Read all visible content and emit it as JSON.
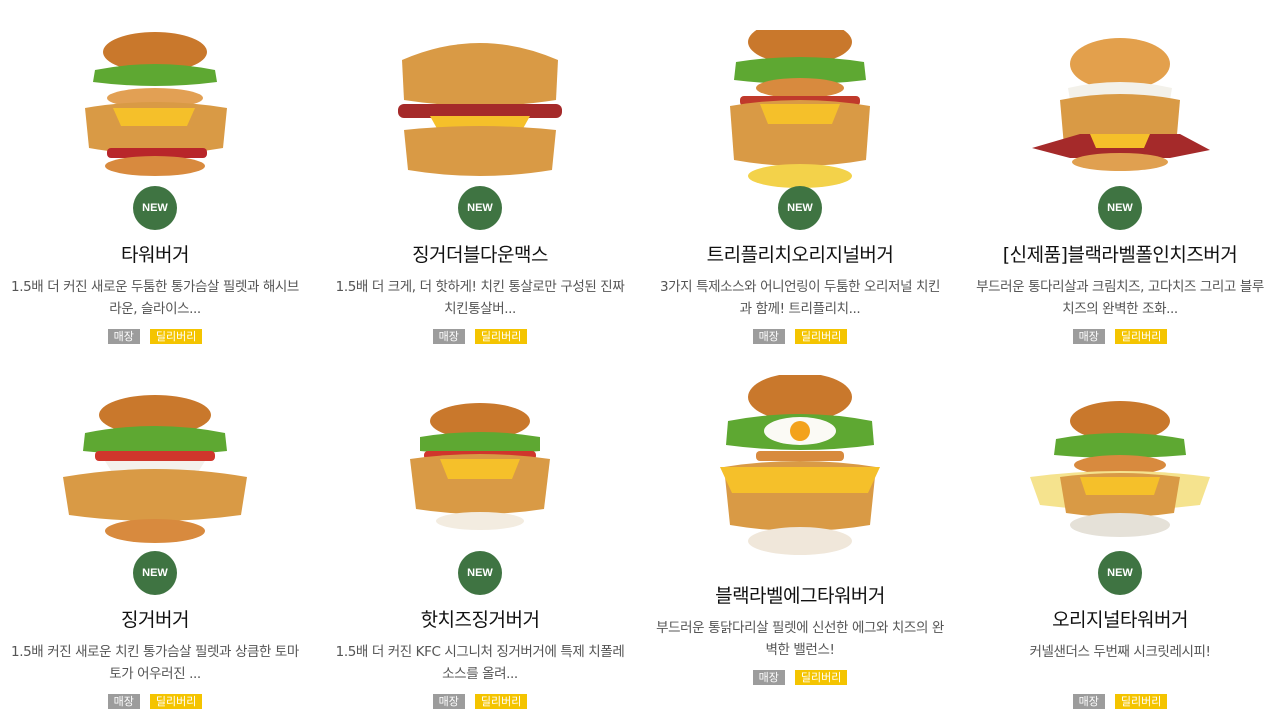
{
  "menu": {
    "items": [
      {
        "name": "타워버거",
        "desc": "1.5배 더 커진 새로운 두툼한 통가슴살 필렛과 해시브라운, 슬라이스...",
        "badge": "NEW",
        "tag_store": "매장",
        "tag_delivery": "딜리버리"
      },
      {
        "name": "징거더블다운맥스",
        "desc": "1.5배 더 크게, 더 핫하게! 치킨 통살로만 구성된 진짜 치킨통살버...",
        "badge": "NEW",
        "tag_store": "매장",
        "tag_delivery": "딜리버리"
      },
      {
        "name": "트리플리치오리지널버거",
        "desc": "3가지 특제소스와 어니언링이 두툼한 오리저널 치킨과 함께! 트리플리치...",
        "badge": "NEW",
        "tag_store": "매장",
        "tag_delivery": "딜리버리"
      },
      {
        "name": "[신제품]블랙라벨폴인치즈버거",
        "desc": "부드러운 통다리살과 크림치즈, 고다치즈 그리고 블루치즈의 완벽한 조화...",
        "badge": "NEW",
        "tag_store": "매장",
        "tag_delivery": "딜리버리"
      },
      {
        "name": "징거버거",
        "desc": "1.5배 커진 새로운 치킨 통가슴살 필렛과 상큼한 토마토가 어우러진 ...",
        "badge": "NEW",
        "tag_store": "매장",
        "tag_delivery": "딜리버리"
      },
      {
        "name": "핫치즈징거버거",
        "desc": "1.5배 더 커진 KFC 시그니처 징거버거에 특제 치폴레 소스를 올려...",
        "badge": "NEW",
        "tag_store": "매장",
        "tag_delivery": "딜리버리"
      },
      {
        "name": "블랙라벨에그타워버거",
        "desc": "부드러운 통닭다리살 필렛에 신선한 에그와 치즈의 완벽한 밸런스!",
        "badge": "",
        "tag_store": "매장",
        "tag_delivery": "딜리버리"
      },
      {
        "name": "오리지널타워버거",
        "desc": "커넬샌더스 두번째 시크릿레시피!",
        "badge": "NEW",
        "tag_store": "매장",
        "tag_delivery": "딜리버리"
      }
    ]
  },
  "colors": {
    "new_badge": "#3f7442",
    "tag_store": "#9c9c9c",
    "tag_delivery": "#f4c400",
    "bun": "#c9782c",
    "lettuce": "#5ea832",
    "chicken": "#d99a45",
    "cheese": "#f5c02a"
  }
}
